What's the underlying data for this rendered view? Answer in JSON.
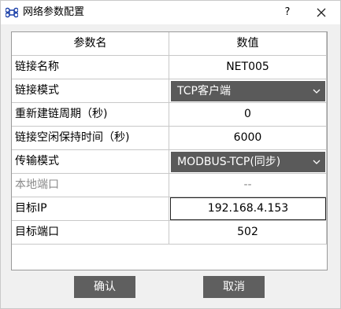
{
  "window": {
    "title": "网络参数配置",
    "help": "?"
  },
  "table": {
    "headers": {
      "name": "参数名",
      "value": "数值"
    },
    "rows": [
      {
        "name": "链接名称",
        "value": "NET005"
      },
      {
        "name": "链接模式",
        "value": "TCP客户端"
      },
      {
        "name": "重新建链周期（秒)",
        "value": "0"
      },
      {
        "name": "链接空闲保持时间（秒)",
        "value": "6000"
      },
      {
        "name": "传输模式",
        "value": "MODBUS-TCP(同步)"
      },
      {
        "name": "本地端口",
        "value": "--"
      },
      {
        "name": "目标IP",
        "value": "192.168.4.153"
      },
      {
        "name": "目标端口",
        "value": "502"
      }
    ]
  },
  "buttons": {
    "ok": "确认",
    "cancel": "取消"
  },
  "colors": {
    "button_bg": "#5f5f5f",
    "dropdown_bg": "#5a5a5a",
    "grid": "#c8c8c8"
  },
  "icons": {
    "app": "command-icon",
    "close": "close-icon",
    "dropdown": "chevron-down-icon"
  }
}
